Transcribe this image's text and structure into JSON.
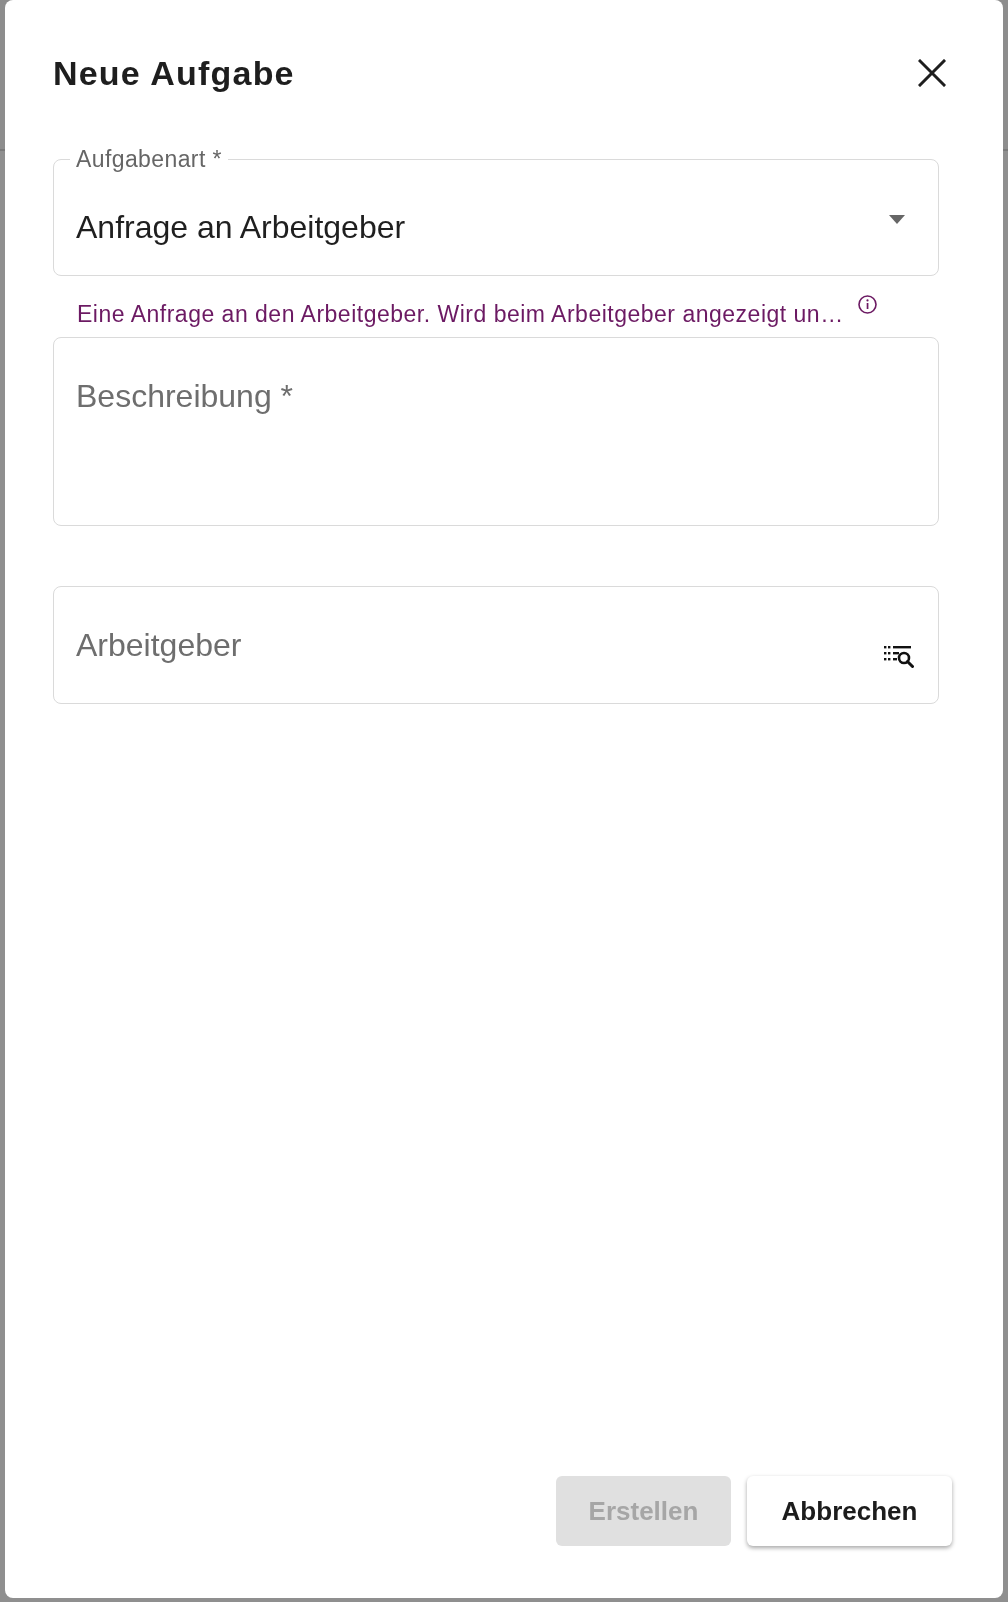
{
  "dialog": {
    "title": "Neue Aufgabe"
  },
  "fields": [
    {
      "kind": "select",
      "label": "Aufgabenart *",
      "value": "Anfrage an Arbeitgeber",
      "helper": "Eine Anfrage an den Arbeitgeber. Wird beim Arbeitgeber angezeigt un…"
    },
    {
      "kind": "textarea",
      "placeholder": "Beschreibung *"
    },
    {
      "kind": "lookup",
      "placeholder": "Arbeitgeber"
    }
  ],
  "buttons": [
    {
      "label": "Erstellen",
      "disabled": true
    },
    {
      "label": "Abbrechen",
      "disabled": false
    }
  ]
}
